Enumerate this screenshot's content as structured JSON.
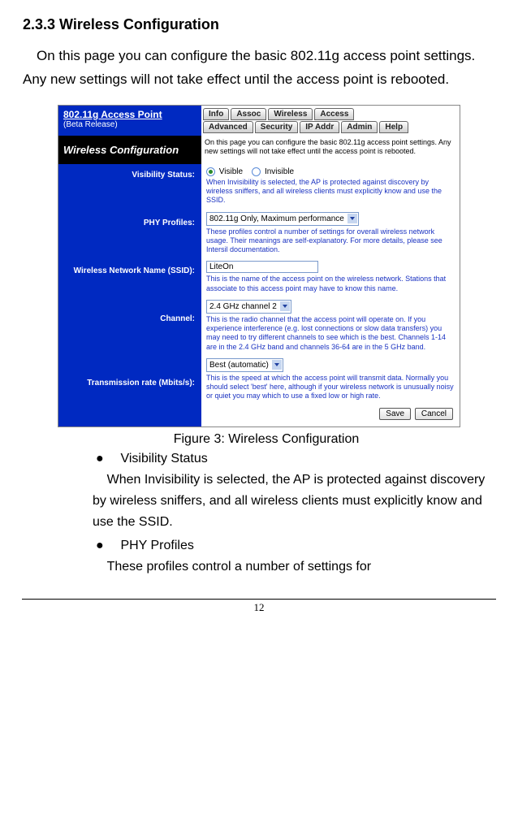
{
  "heading": "2.3.3  Wireless Configuration",
  "intro": "On this page you can configure the basic 802.11g access point settings. Any new settings will not take effect until the access point is rebooted.",
  "screenshot": {
    "app_title": "802.11g Access Point",
    "app_sub": "(Beta Release)",
    "tabs_row1": [
      "Info",
      "Assoc",
      "Wireless",
      "Access"
    ],
    "tabs_row2": [
      "Advanced",
      "Security",
      "IP Addr",
      "Admin",
      "Help"
    ],
    "panel_title": "Wireless Configuration",
    "panel_desc": "On this page you can configure the basic 802.11g access point settings. Any new settings will not take effect until the access point is rebooted.",
    "fields": {
      "visibility": {
        "label": "Visibility Status:",
        "opt_visible": "Visible",
        "opt_invisible": "Invisible",
        "help": "When Invisibility is selected, the AP is protected against discovery by wireless sniffers, and all wireless clients must explicitly know and use the SSID."
      },
      "phy": {
        "label": "PHY Profiles:",
        "value": "802.11g Only, Maximum performance",
        "help": "These profiles control a number of settings for overall wireless network usage. Their meanings are self-explanatory. For more details, please see Intersil documentation."
      },
      "ssid": {
        "label": "Wireless Network Name (SSID):",
        "value": "LiteOn",
        "help": "This is the name of the access point on the wireless network. Stations that associate to this access point may have to know this name."
      },
      "channel": {
        "label": "Channel:",
        "value": "2.4 GHz channel 2",
        "help": "This is the radio channel that the access point will operate on. If you experience interference (e.g. lost connections or slow data transfers) you may need to try different channels to see which is the best. Channels 1-14 are in the 2.4 GHz band and channels 36-64 are in the 5 GHz band."
      },
      "rate": {
        "label": "Transmission rate (Mbits/s):",
        "value": "Best (automatic)",
        "help": "This is the speed at which the access point will transmit data. Normally you should select 'best' here, although if your wireless network is unusually noisy or quiet you may which to use a fixed low or high rate."
      }
    },
    "buttons": {
      "save": "Save",
      "cancel": "Cancel"
    }
  },
  "caption": "Figure 3: Wireless Configuration",
  "bullets": {
    "b1_title": "Visibility Status",
    "b1_body": "When Invisibility is selected, the AP is protected against discovery by wireless sniffers, and all wireless clients must explicitly know and use the SSID.",
    "b2_title": "PHY Profiles",
    "b2_body": "These profiles control a number of settings for"
  },
  "page_number": "12"
}
